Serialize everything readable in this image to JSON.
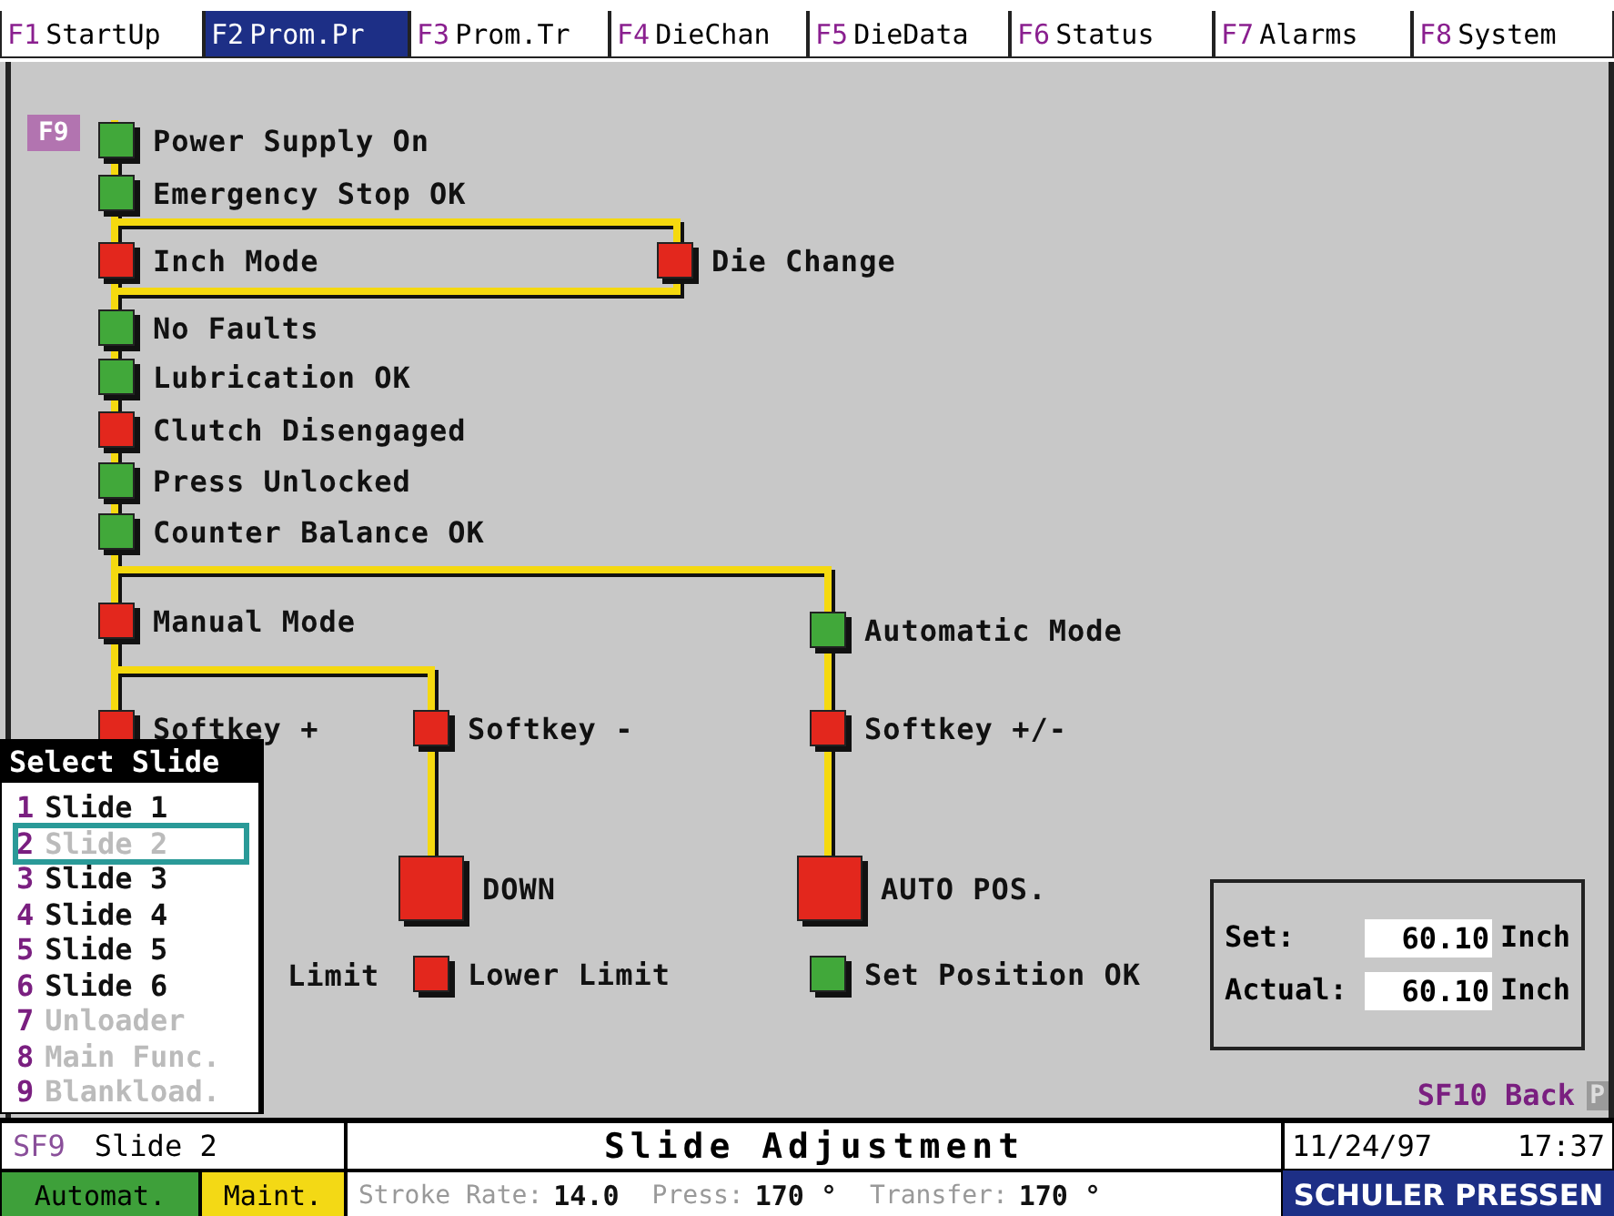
{
  "tabs": [
    {
      "key": "F1",
      "label": "StartUp",
      "selected": false
    },
    {
      "key": "F2",
      "label": "Prom.Pr",
      "selected": true
    },
    {
      "key": "F3",
      "label": "Prom.Tr",
      "selected": false
    },
    {
      "key": "F4",
      "label": "DieChan",
      "selected": false
    },
    {
      "key": "F5",
      "label": "DieData",
      "selected": false
    },
    {
      "key": "F6",
      "label": "Status",
      "selected": false
    },
    {
      "key": "F7",
      "label": "Alarms",
      "selected": false
    },
    {
      "key": "F8",
      "label": "System",
      "selected": false
    }
  ],
  "diagram": {
    "f9_key": "F9",
    "nodes": [
      {
        "kind": "lamp",
        "label": "Power Supply On",
        "on": true
      },
      {
        "kind": "lamp",
        "label": "Emergency Stop OK",
        "on": true
      },
      {
        "kind": "lamp",
        "label": "Inch Mode",
        "on": false
      },
      {
        "kind": "lamp",
        "label": "Die Change",
        "on": false
      },
      {
        "kind": "lamp",
        "label": "No Faults",
        "on": true
      },
      {
        "kind": "lamp",
        "label": "Lubrication OK",
        "on": true
      },
      {
        "kind": "lamp",
        "label": "Clutch Disengaged",
        "on": false
      },
      {
        "kind": "lamp",
        "label": "Press Unlocked",
        "on": true
      },
      {
        "kind": "lamp",
        "label": "Counter Balance OK",
        "on": true
      },
      {
        "kind": "lamp",
        "label": "Manual Mode",
        "on": false
      },
      {
        "kind": "lamp",
        "label": "Automatic Mode",
        "on": true
      },
      {
        "kind": "lamp",
        "label": "Softkey +",
        "on": false
      },
      {
        "kind": "lamp",
        "label": "Softkey -",
        "on": false
      },
      {
        "kind": "lamp",
        "label": "Softkey +/-",
        "on": false
      },
      {
        "kind": "big-lamp",
        "label": "DOWN",
        "on": false
      },
      {
        "kind": "big-lamp",
        "label": "AUTO POS.",
        "on": false
      },
      {
        "kind": "label",
        "label": "Limit"
      },
      {
        "kind": "lamp",
        "label": "Lower Limit",
        "on": false
      },
      {
        "kind": "lamp",
        "label": "Set Position OK",
        "on": true
      }
    ]
  },
  "slide_menu": {
    "title": "Select Slide",
    "items": [
      {
        "number": "1",
        "label": "Slide 1",
        "enabled": true,
        "selected": false
      },
      {
        "number": "2",
        "label": "Slide 2",
        "enabled": false,
        "selected": true
      },
      {
        "number": "3",
        "label": "Slide 3",
        "enabled": true,
        "selected": false
      },
      {
        "number": "4",
        "label": "Slide 4",
        "enabled": true,
        "selected": false
      },
      {
        "number": "5",
        "label": "Slide 5",
        "enabled": true,
        "selected": false
      },
      {
        "number": "6",
        "label": "Slide 6",
        "enabled": true,
        "selected": false
      },
      {
        "number": "7",
        "label": "Unloader",
        "enabled": false,
        "selected": false
      },
      {
        "number": "8",
        "label": "Main Func.",
        "enabled": false,
        "selected": false
      },
      {
        "number": "9",
        "label": "Blankload.",
        "enabled": false,
        "selected": false
      }
    ]
  },
  "position_box": {
    "rows": [
      {
        "label": "Set:",
        "value": "60.10",
        "unit": "Inch"
      },
      {
        "label": "Actual:",
        "value": "60.10",
        "unit": "Inch"
      }
    ]
  },
  "back_softkey": {
    "key": "SF10",
    "label": "Back",
    "marker": "P"
  },
  "status_bar": {
    "softkey": {
      "key": "SF9",
      "label": "Slide 2"
    },
    "title": "Slide Adjustment",
    "date": "11/24/97",
    "time": "17:37",
    "modes": [
      {
        "label": "Automat.",
        "kind": "auto"
      },
      {
        "label": "Maint.",
        "kind": "maint"
      }
    ],
    "readings": [
      {
        "label": "Stroke Rate:",
        "value": "14.0"
      },
      {
        "label": "Press:",
        "value": "170 °"
      },
      {
        "label": "Transfer:",
        "value": "170 °"
      }
    ],
    "brand": "SCHULER PRESSEN"
  }
}
